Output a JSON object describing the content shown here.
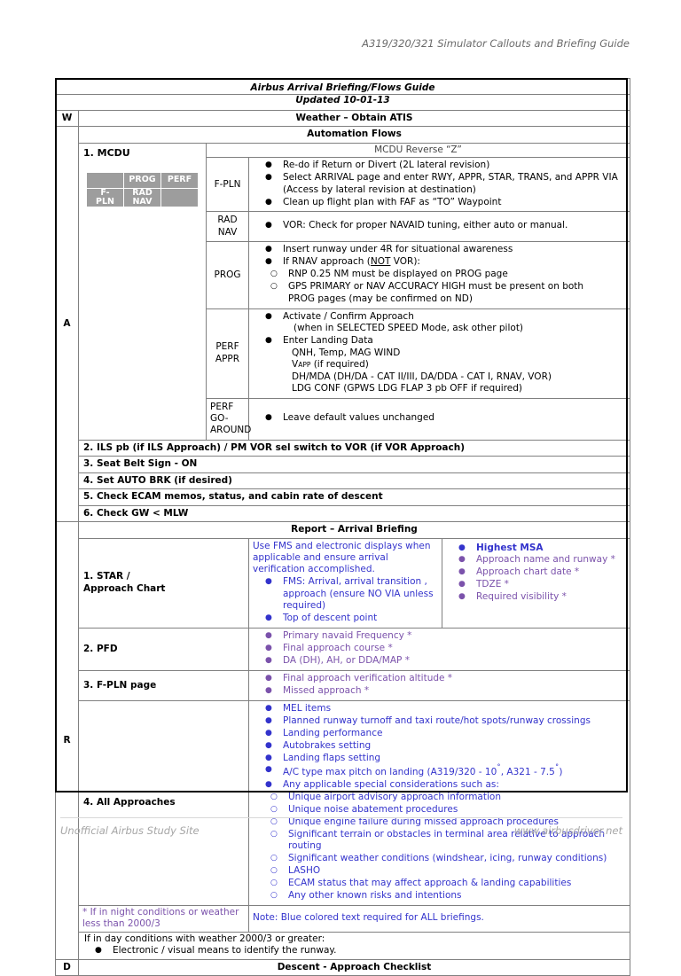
{
  "doc": {
    "header_right": "A319/320/321 Simulator Callouts and Briefing Guide",
    "title": "Airbus Arrival Briefing/Flows Guide",
    "subtitle": "Updated 10-01-13",
    "footer_left": "Unofficial Airbus Study Site",
    "footer_right": "www.airbusdriver.net"
  },
  "colors": {
    "blue": "#3333cc",
    "purple": "#7b52ab",
    "mcdu_gray": "#9d9d9d",
    "border": "#808080",
    "header_gray": "#6b6b6b"
  },
  "sections": {
    "weather": {
      "letter": "W",
      "band": "Weather – Obtain ATIS"
    },
    "automation": {
      "letter": "A",
      "band": "Automation Flows",
      "mcdu_caption": "MCDU Reverse “Z”",
      "mcdu_label": "1. MCDU",
      "mcdu_keys": {
        "r1c1": "",
        "r1c2": "PROG",
        "r1c3": "PERF",
        "r2c1": "F-\nPLN",
        "r2c2": "RAD\nNAV",
        "r2c3": ""
      },
      "rows": [
        {
          "sublabel": "F-PLN",
          "items": [
            {
              "text": "Re-do if Return or Divert (2L lateral revision)"
            },
            {
              "text": "Select ARRIVAL page and enter RWY, APPR, STAR, TRANS, and APPR VIA",
              "cont": "(Access by lateral revision at destination)"
            },
            {
              "text": "Clean up flight plan with FAF as “TO” Waypoint"
            }
          ]
        },
        {
          "sublabel": "RAD\nNAV",
          "items": [
            {
              "text": "VOR: Check for proper NAVAID tuning, either auto or manual."
            }
          ]
        },
        {
          "sublabel": "PROG",
          "items": [
            {
              "text": "Insert runway under 4R for situational awareness"
            },
            {
              "text_pre": "If RNAV approach (",
              "text_u": "NOT",
              "text_post": " VOR):"
            }
          ],
          "subitems": [
            {
              "text": "RNP 0.25 NM must be displayed on PROG page"
            },
            {
              "text": "GPS PRIMARY or NAV ACCURACY HIGH must be present on both",
              "cont": "PROG pages (may be confirmed on ND)"
            }
          ]
        },
        {
          "sublabel": "PERF\nAPPR",
          "items": [
            {
              "text": "Activate / Confirm Approach",
              "cont": "(when in SELECTED SPEED Mode, ask other pilot)"
            },
            {
              "text": "Enter Landing Data"
            }
          ],
          "plain_lines": [
            "QNH, Temp, MAG WIND",
            "V<sc>APP</sc> (if required)",
            "DH/MDA (DH/DA - CAT II/III, DA/DDA - CAT I, RNAV, VOR)",
            "LDG CONF (GPWS LDG FLAP 3 pb OFF if required)"
          ]
        },
        {
          "sublabel": "PERF\nGO-\nAROUND",
          "items": [
            {
              "text": "Leave default values unchanged"
            }
          ]
        }
      ],
      "numbered": [
        "2. ILS pb (if ILS Approach) / PM VOR sel switch to VOR (if VOR Approach)",
        "3. Seat Belt Sign - ON",
        "4. Set AUTO BRK (if desired)",
        "5. Check ECAM memos, status, and cabin rate of descent",
        "6. Check GW < MLW"
      ]
    },
    "report": {
      "letter": "R",
      "band": "Report – Arrival Briefing",
      "star": {
        "label": "1. STAR /\nApproach Chart",
        "intro": "Use FMS and electronic displays when applicable and ensure arrival verification accomplished.",
        "left_items": [
          {
            "text": "FMS: Arrival, arrival transition , approach (ensure NO VIA unless required)"
          },
          {
            "text": "Top of descent point"
          }
        ],
        "right_items": [
          {
            "text": "Highest MSA",
            "style": "blue-bold"
          },
          {
            "text": "Approach name and runway *",
            "style": "purple"
          },
          {
            "text": "Approach chart date *",
            "style": "purple"
          },
          {
            "text": "TDZE *",
            "style": "purple"
          },
          {
            "text": "Required visibility *",
            "style": "purple"
          }
        ]
      },
      "pfd": {
        "label": "2. PFD",
        "items": [
          "Primary navaid Frequency *",
          "Final approach course *",
          "DA (DH), AH, or DDA/MAP *"
        ]
      },
      "fpln": {
        "label": "3. F-PLN page",
        "items": [
          "Final approach verification altitude *",
          "Missed approach *"
        ]
      },
      "all_approaches": {
        "label": "4. All Approaches",
        "items": [
          "MEL items",
          "Planned runway turnoff and taxi route/hot spots/runway crossings",
          "Landing performance",
          "Autobrakes setting",
          "Landing flaps setting",
          "A/C type max pitch on landing (A319/320 - 10<deg>˚</deg>, A321 - 7.5<deg>˚</deg>)",
          "Any applicable special considerations such as:"
        ],
        "subitems": [
          "Unique airport advisory approach information",
          "Unique noise abatement procedures",
          "Unique engine failure during missed approach procedures",
          "Significant terrain or obstacles in terminal area relative to approach routing",
          "Significant weather conditions (windshear, icing, runway conditions)",
          "LASHO",
          "ECAM status that may affect approach & landing capabilities",
          "Any other known risks and intentions"
        ]
      },
      "footnote_left": "* If in night conditions or weather less than 2000/3",
      "footnote_right": "Note: Blue colored text required for ALL briefings.",
      "day_note": "If in day conditions with weather 2000/3 or greater:",
      "day_note_item": "Electronic / visual means to identify the runway."
    },
    "descent": {
      "letter": "D",
      "band": "Descent - Approach Checklist"
    }
  }
}
